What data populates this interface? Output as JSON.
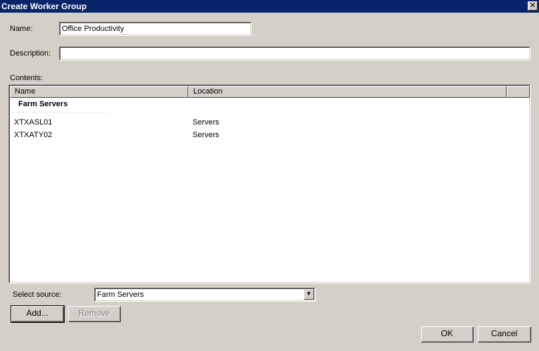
{
  "window": {
    "title": "Create Worker Group",
    "close_glyph": "✕"
  },
  "form": {
    "name_label": "Name:",
    "name_value": "Office Productivity",
    "description_label": "Description:",
    "description_value": "",
    "contents_label": "Contents:"
  },
  "list": {
    "columns": [
      "Name",
      "Location"
    ],
    "group": "Farm Servers",
    "rows": [
      {
        "name": "XTXASL01",
        "location": "Servers"
      },
      {
        "name": "XTXATY02",
        "location": "Servers"
      }
    ]
  },
  "source": {
    "label": "Select source:",
    "selected": "Farm Servers",
    "arrow_glyph": "▼"
  },
  "buttons": {
    "add": "Add...",
    "remove": "Remove",
    "ok": "OK",
    "cancel": "Cancel"
  },
  "colors": {
    "titlebar": "#0a246a",
    "dialog_bg": "#d4d0c8"
  }
}
